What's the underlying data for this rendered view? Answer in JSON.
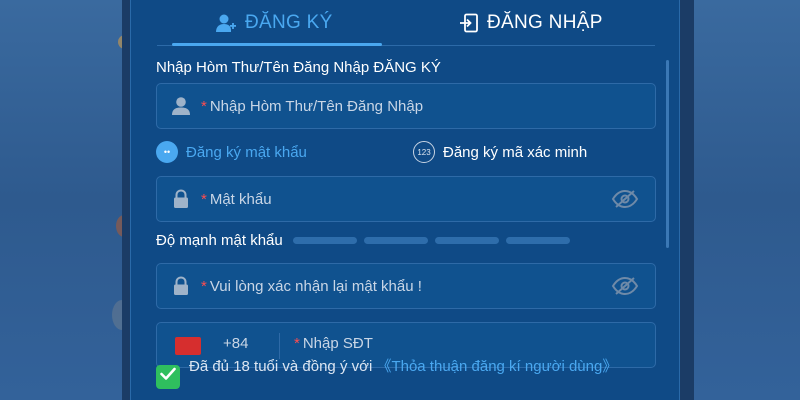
{
  "tabs": {
    "register_label": "ĐĂNG KÝ",
    "login_label": "ĐĂNG NHẬP"
  },
  "form": {
    "section_title": "Nhập Hòm Thư/Tên Đăng Nhập ĐĂNG KÝ",
    "username": {
      "required_mark": "*",
      "placeholder": "Nhập Hòm Thư/Tên Đăng Nhập"
    },
    "option_password": {
      "badge": "••",
      "label": "Đăng ký mật khẩu",
      "selected": true
    },
    "option_code": {
      "badge": "123",
      "label": "Đăng ký mã xác minh",
      "selected": false
    },
    "password": {
      "required_mark": "*",
      "placeholder": "Mật khẩu"
    },
    "strength_label": "Độ mạnh mật khẩu",
    "confirm": {
      "required_mark": "*",
      "placeholder": "Vui lòng xác nhận lại mật khẩu !"
    },
    "phone": {
      "country_code": "+84",
      "required_mark": "*",
      "placeholder": "Nhập SĐT"
    },
    "agree": {
      "checked": true,
      "text": "Đã đủ 18 tuổi và đồng ý với",
      "link": "《Thỏa thuận đăng kí người dùng》"
    }
  },
  "colors": {
    "panel_bg": "#0f4a86",
    "accent": "#4aa8f0",
    "check": "#2fbf5e",
    "required": "#ff4d4f"
  },
  "icons": [
    "user-add-icon",
    "login-icon",
    "user-icon",
    "lock-icon",
    "eye-off-icon",
    "flag-icon",
    "checkmark-icon"
  ]
}
